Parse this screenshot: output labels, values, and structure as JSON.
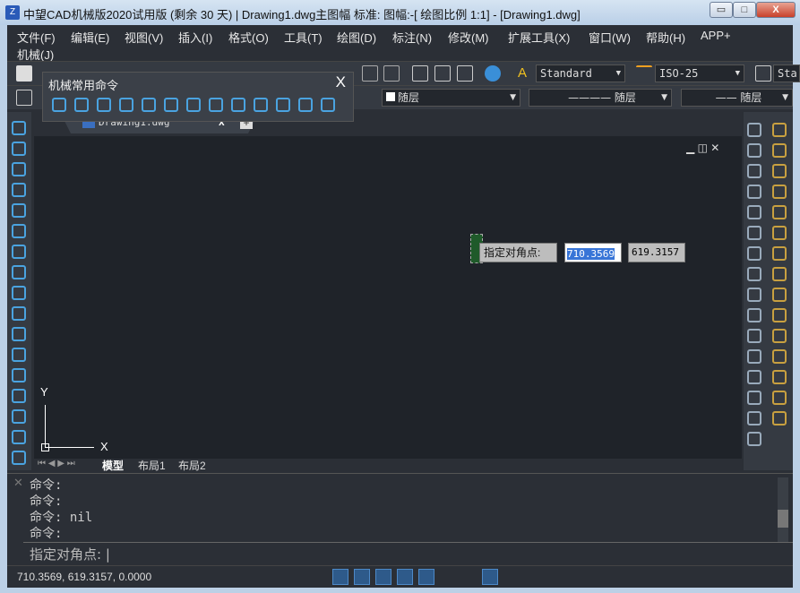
{
  "window": {
    "title": "中望CAD机械版2020试用版 (剩余 30 天) | Drawing1.dwg主图幅  标准: 图幅:-[ 绘图比例 1:1] - [Drawing1.dwg]",
    "minimize": "▭",
    "maximize": "□",
    "close": "X"
  },
  "menu": [
    "文件(F)",
    "编辑(E)",
    "视图(V)",
    "插入(I)",
    "格式(O)",
    "工具(T)",
    "绘图(D)",
    "标注(N)",
    "修改(M)",
    "扩展工具(X)",
    "窗口(W)",
    "帮助(H)",
    "APP+",
    "机械(J)"
  ],
  "toolbar": {
    "text_style": "Standard",
    "dim_style": "ISO-25",
    "table_style": "Sta",
    "color": "随层",
    "linetype": "———— 随层",
    "lineweight": "—— 随层"
  },
  "panel": {
    "title": "机械常用命令",
    "close": "X"
  },
  "doc_tab": {
    "label": "Drawing1.dwg",
    "close": "X",
    "add": "+"
  },
  "canvas": {
    "prompt_label": "指定对角点:",
    "x_value": "710.3569",
    "y_value": "619.3157",
    "axis_x": "X",
    "axis_y": "Y"
  },
  "layout_tabs": [
    "模型",
    "布局1",
    "布局2"
  ],
  "command": {
    "history": [
      "命令:",
      "命令:",
      "命令: nil",
      "命令:"
    ],
    "prompt": "指定对角点:"
  },
  "status": {
    "coords": "710.3569, 619.3157, 0.0000"
  },
  "colors": {
    "canvas": "#1f2329",
    "accent": "#2e5a8a",
    "selection": "#3875d7"
  }
}
